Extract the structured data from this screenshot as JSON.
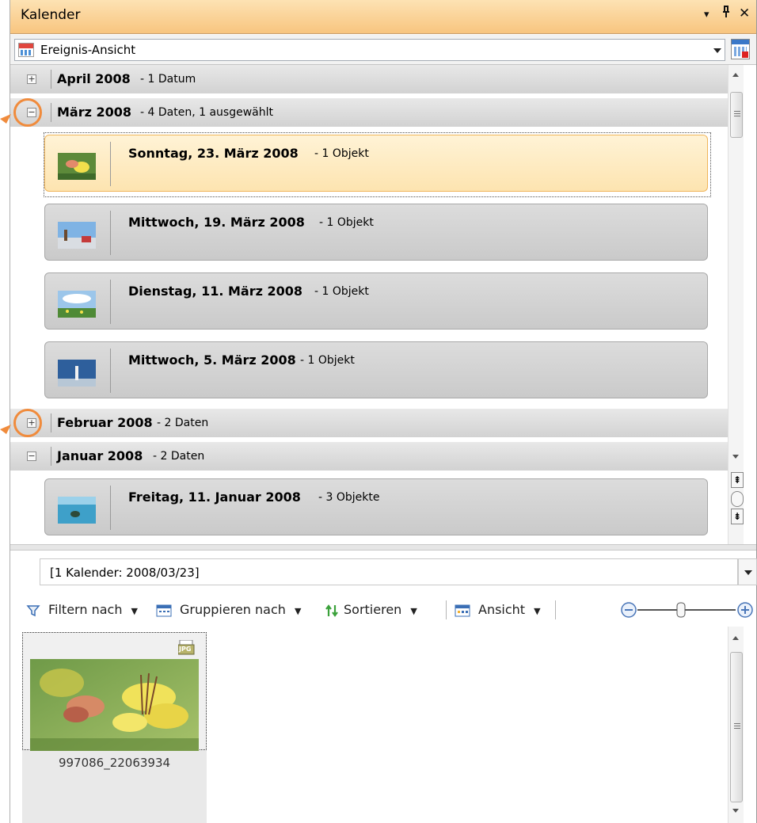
{
  "window": {
    "title": "Kalender",
    "controls": [
      "▾",
      "ᵒ",
      "✕"
    ]
  },
  "view_selector": {
    "value": "Ereignis-Ansicht"
  },
  "tree": {
    "groups": [
      {
        "title": "April 2008",
        "subtitle": "- 1 Datum",
        "expanded": false
      },
      {
        "title": "März 2008",
        "subtitle": "- 4 Daten, 1 ausgewählt",
        "expanded": true
      },
      {
        "title": "Februar 2008",
        "subtitle": "- 2 Daten",
        "expanded": false
      },
      {
        "title": "Januar 2008",
        "subtitle": "- 2 Daten",
        "expanded": true
      }
    ],
    "items": [
      {
        "title": "Sonntag, 23. März 2008",
        "subtitle": "- 1 Objekt",
        "selected": true
      },
      {
        "title": "Mittwoch, 19. März 2008",
        "subtitle": "- 1 Objekt",
        "selected": false
      },
      {
        "title": "Dienstag, 11. März 2008",
        "subtitle": "- 1 Objekt",
        "selected": false
      },
      {
        "title": "Mittwoch, 5. März 2008",
        "subtitle": "- 1 Objekt",
        "selected": false
      },
      {
        "title": "Freitag, 11. Januar 2008",
        "subtitle": "- 3 Objekte",
        "selected": false
      }
    ]
  },
  "filter": {
    "value": "[1 Kalender: 2008/03/23]"
  },
  "toolbar": {
    "filter_label": "Filtern nach",
    "group_label": "Gruppieren nach",
    "sort_label": "Sortieren",
    "view_label": "Ansicht",
    "zoom_minus": "−",
    "zoom_plus": "+"
  },
  "thumbnail": {
    "badge": "JPG",
    "caption": "997086_22063934"
  },
  "colors": {
    "title_bar": "#f8c57f",
    "selected_item": "#fde4b0",
    "callout_ring": "#f08b3c"
  }
}
